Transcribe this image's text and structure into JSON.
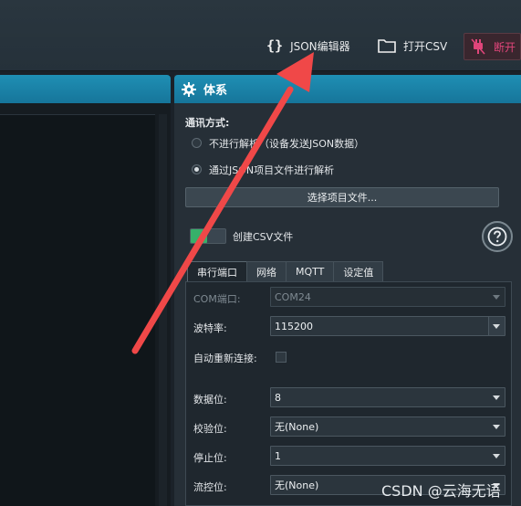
{
  "toolbar": {
    "json_editor_label": "JSON编辑器",
    "open_csv_label": "打开CSV",
    "disconnect_label": "断开"
  },
  "panel": {
    "title": "体系",
    "comm_mode_label": "通讯方式:",
    "option_no_parse": "不进行解析（设备发送JSON数据）",
    "option_parse_project": "通过JSON项目文件进行解析",
    "selected_option": "option_parse_project",
    "select_file_button": "选择项目文件...",
    "create_csv_label": "创建CSV文件",
    "create_csv_on": true,
    "help_icon": "help-icon"
  },
  "tabs": [
    {
      "label": "串行端口",
      "active": true
    },
    {
      "label": "网络",
      "active": false
    },
    {
      "label": "MQTT",
      "active": false
    },
    {
      "label": "设定值",
      "active": false
    }
  ],
  "serial": {
    "com_port_label": "COM端口:",
    "com_port_value": "COM24",
    "baud_label": "波特率:",
    "baud_value": "115200",
    "auto_reconnect_label": "自动重新连接:",
    "auto_reconnect_checked": false,
    "data_bits_label": "数据位:",
    "data_bits_value": "8",
    "parity_label": "校验位:",
    "parity_value": "无(None)",
    "stop_bits_label": "停止位:",
    "stop_bits_value": "1",
    "flow_control_label": "流控位:",
    "flow_control_value": "无(None)"
  },
  "watermark": "CSDN @云海无语",
  "colors": {
    "accent_header": "#1a84aa",
    "annotation_arrow": "#f04848",
    "toggle_on": "#37b06a",
    "disconnect": "#e0457a"
  }
}
